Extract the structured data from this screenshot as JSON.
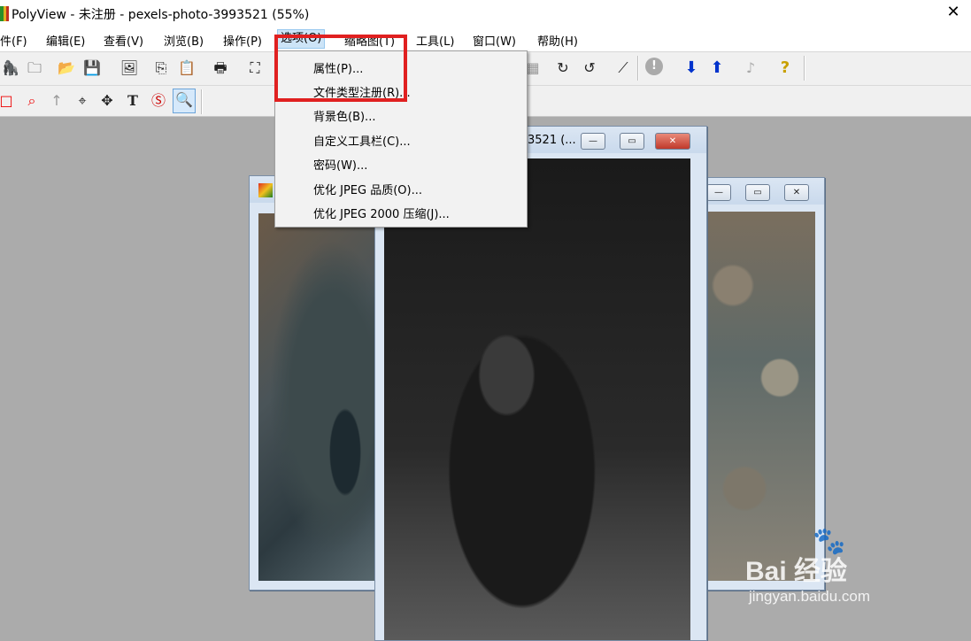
{
  "window": {
    "title": "PolyView - 未注册 - pexels-photo-3993521 (55%)",
    "close_glyph": "✕"
  },
  "menubar": {
    "items": [
      {
        "label": "件(F)"
      },
      {
        "label": "编辑(E)"
      },
      {
        "label": "查看(V)"
      },
      {
        "label": "浏览(B)"
      },
      {
        "label": "操作(P)"
      },
      {
        "label": "选项(O)"
      },
      {
        "label": "缩略图(T)"
      },
      {
        "label": "工具(L)"
      },
      {
        "label": "窗口(W)"
      },
      {
        "label": "帮助(H)"
      }
    ]
  },
  "options_menu": {
    "items": [
      {
        "label": "属性(P)..."
      },
      {
        "label": "文件类型注册(R)..."
      },
      {
        "label": "背景色(B)..."
      },
      {
        "label": "自定义工具栏(C)..."
      },
      {
        "label": "密码(W)..."
      },
      {
        "label": "优化 JPEG 品质(O)..."
      },
      {
        "label": "优化 JPEG 2000 压缩(J)..."
      }
    ]
  },
  "child_windows": {
    "middle_title": "3521 (...",
    "cap_min": "—",
    "cap_max": "▭",
    "cap_close": "✕"
  },
  "toolbar_icons": {
    "tb1": [
      "🦍",
      "🗀",
      "📂",
      "💾",
      "🖼",
      "⎘",
      "📋",
      "🖶",
      "⛶",
      "▦",
      "↻",
      "↺",
      "⟋",
      "!",
      "⬇",
      "⬆",
      "♪",
      "?"
    ],
    "tb2": [
      "□",
      "⌕",
      "↑",
      "⌖",
      "✥",
      "T",
      "Ⓢ",
      "🔍"
    ]
  },
  "watermark": {
    "paw": "🐾",
    "logo": "Bai 经验",
    "url": "jingyan.baidu.com"
  },
  "colors": {
    "highlight": "#e02020",
    "menu_bg": "#f2f2f2",
    "mdi_bg": "#ababab"
  }
}
